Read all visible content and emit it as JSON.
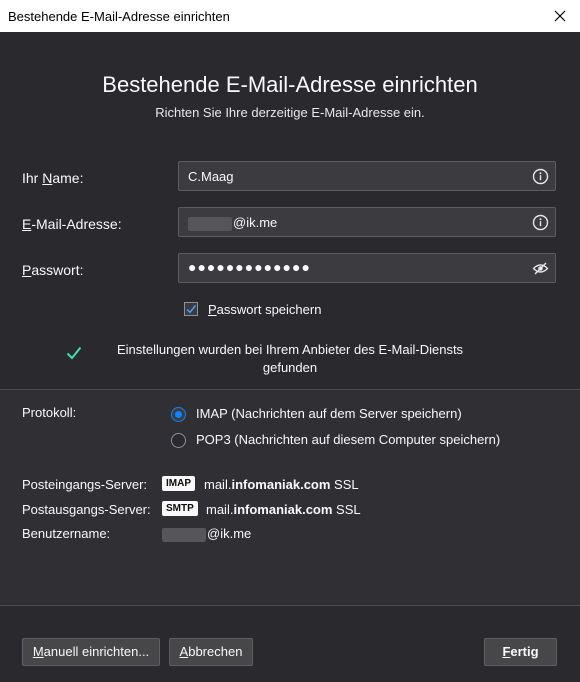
{
  "window": {
    "title": "Bestehende E-Mail-Adresse einrichten"
  },
  "header": {
    "title": "Bestehende E-Mail-Adresse einrichten",
    "subtitle": "Richten Sie Ihre derzeitige E-Mail-Adresse ein."
  },
  "form": {
    "name": {
      "label_pre": "Ihr ",
      "label_u": "N",
      "label_post": "ame:",
      "value": "C.Maag"
    },
    "email": {
      "label_u": "E",
      "label_post": "-Mail-Adresse:",
      "value_suffix": "@ik.me"
    },
    "password": {
      "label_u": "P",
      "label_post": "asswort:",
      "value": "●●●●●●●●●●●●●"
    },
    "remember": {
      "label_u": "P",
      "label_post": "asswort speichern",
      "checked": true
    }
  },
  "status": {
    "text": "Einstellungen wurden bei Ihrem Anbieter des E-Mail-Diensts gefunden",
    "color": "#54ffbd"
  },
  "protocol": {
    "label": "Protokoll:",
    "options": [
      {
        "label": "IMAP (Nachrichten auf dem Server speichern)",
        "selected": true
      },
      {
        "label": "POP3 (Nachrichten auf diesem Computer speichern)",
        "selected": false
      }
    ]
  },
  "servers": {
    "incoming": {
      "label": "Posteingangs-Server:",
      "badge": "IMAP",
      "host_prefix": "mail.",
      "host_bold": "infomaniak.com",
      "security": "SSL"
    },
    "outgoing": {
      "label": "Postausgangs-Server:",
      "badge": "SMTP",
      "host_prefix": "mail.",
      "host_bold": "infomaniak.com",
      "security": "SSL"
    },
    "username": {
      "label": "Benutzername:",
      "value_suffix": "@ik.me"
    }
  },
  "buttons": {
    "manual": {
      "label_u": "M",
      "label_post": "anuell einrichten..."
    },
    "cancel": {
      "label_u": "A",
      "label_post": "bbrechen"
    },
    "done": {
      "label_u": "F",
      "label_post": "ertig"
    }
  },
  "colors": {
    "accent": "#0a84ff",
    "background": "#2a2a2e"
  }
}
